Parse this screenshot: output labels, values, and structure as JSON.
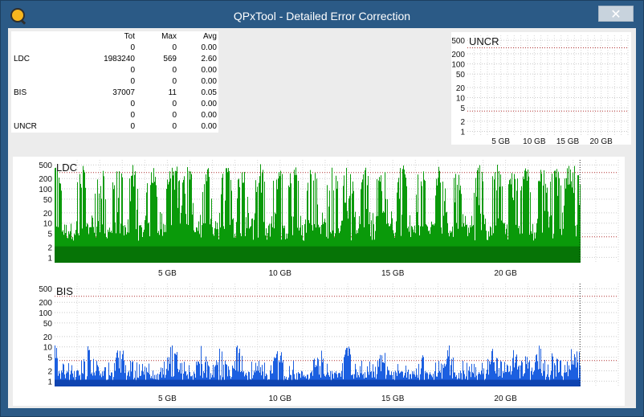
{
  "window": {
    "title": "QPxTool - Detailed Error Correction",
    "close_glyph": "✕"
  },
  "stats": {
    "headers": [
      "",
      "Tot",
      "Max",
      "Avg"
    ],
    "rows": [
      [
        "",
        "0",
        "0",
        "0.00"
      ],
      [
        "LDC",
        "1983240",
        "569",
        "2.60"
      ],
      [
        "",
        "0",
        "0",
        "0.00"
      ],
      [
        "",
        "0",
        "0",
        "0.00"
      ],
      [
        "BIS",
        "37007",
        "11",
        "0.05"
      ],
      [
        "",
        "0",
        "0",
        "0.00"
      ],
      [
        "",
        "0",
        "0",
        "0.00"
      ],
      [
        "UNCR",
        "0",
        "0",
        "0.00"
      ]
    ]
  },
  "chart_data": [
    {
      "type": "area",
      "title": "UNCR",
      "yscale": "log",
      "y_ticks": [
        "500",
        "200",
        "100",
        "50",
        "20",
        "10",
        "5",
        "2",
        "1"
      ],
      "y_tick_values": [
        500,
        200,
        100,
        50,
        20,
        10,
        5,
        2,
        1
      ],
      "x_ticks": [
        "5 GB",
        "10 GB",
        "15 GB",
        "20 GB"
      ],
      "x_tick_values": [
        5,
        10,
        15,
        20
      ],
      "xlim": [
        0,
        24
      ],
      "ylim": [
        0.7,
        700
      ],
      "threshold_lines": [
        300,
        4
      ],
      "series": [
        {
          "color": "#e03030",
          "values": []
        }
      ]
    },
    {
      "type": "area",
      "title": "LDC",
      "yscale": "log",
      "y_ticks": [
        "500",
        "200",
        "100",
        "50",
        "20",
        "10",
        "5",
        "2",
        "1"
      ],
      "y_tick_values": [
        500,
        200,
        100,
        50,
        20,
        10,
        5,
        2,
        1
      ],
      "x_ticks": [
        "5 GB",
        "10 GB",
        "15 GB",
        "20 GB"
      ],
      "x_tick_values": [
        5,
        10,
        15,
        20
      ],
      "xlim": [
        0,
        25
      ],
      "ylim": [
        0.7,
        700
      ],
      "data_end": 23.3,
      "threshold_lines": [
        300,
        4
      ],
      "series": [
        {
          "name": "LDC",
          "color": "#0a9a0a",
          "dark_color": "#066d06",
          "base": 3,
          "typical": 20,
          "peak": 569
        }
      ],
      "peak_positions": [
        0.1,
        1.2,
        2.0,
        2.8,
        3.5,
        4.3,
        5.2,
        5.4,
        5.9,
        6.8,
        7.6,
        8.3,
        9.1,
        9.9,
        10.6,
        11.4,
        12.3,
        13.0,
        13.8,
        14.5,
        15.4,
        16.2,
        17.1,
        17.9,
        18.8,
        19.6,
        20.3,
        20.9,
        21.6,
        22.2,
        22.8,
        23.1
      ]
    },
    {
      "type": "area",
      "title": "BIS",
      "yscale": "log",
      "y_ticks": [
        "500",
        "200",
        "100",
        "50",
        "20",
        "10",
        "5",
        "2",
        "1"
      ],
      "y_tick_values": [
        500,
        200,
        100,
        50,
        20,
        10,
        5,
        2,
        1
      ],
      "x_ticks": [
        "5 GB",
        "10 GB",
        "15 GB",
        "20 GB"
      ],
      "x_tick_values": [
        5,
        10,
        15,
        20
      ],
      "xlim": [
        0,
        25
      ],
      "ylim": [
        0.7,
        700
      ],
      "data_end": 23.3,
      "threshold_lines": [
        300,
        4
      ],
      "series": [
        {
          "name": "BIS",
          "color": "#1c5fe0",
          "dark_color": "#0d3fa8",
          "base": 1,
          "typical": 3,
          "peak": 11
        }
      ],
      "peak_positions": [
        0.0,
        1.5,
        2.9,
        5.2,
        5.4,
        6.5,
        7.3,
        8.1,
        9.9,
        11.7,
        13.0,
        14.6,
        16.3,
        17.5,
        19.4,
        20.3,
        20.8,
        21.5,
        22.2,
        22.9,
        23.2
      ]
    }
  ]
}
